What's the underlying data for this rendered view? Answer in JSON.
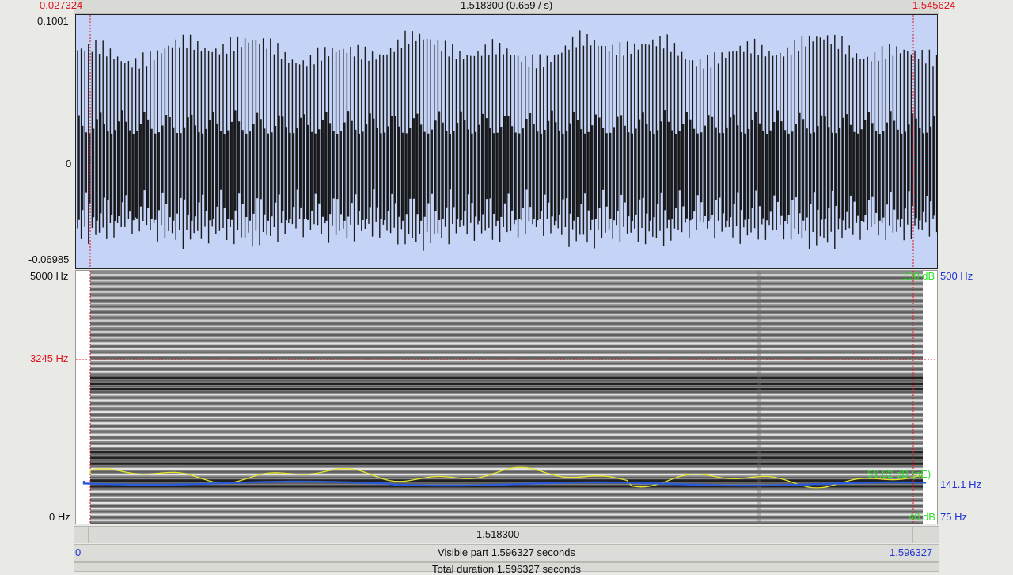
{
  "top": {
    "left_time": "0.027324",
    "selection": "1.518300 (0.659 / s)",
    "right_time": "1.545624"
  },
  "waveform": {
    "max_label": "0.1001",
    "zero_label": "0",
    "min_label": "-0.06985"
  },
  "spectrogram": {
    "top_label": "5000 Hz",
    "cursor_label": "3245 Hz",
    "bottom_label": "0 Hz",
    "right_db_top": "100 dB",
    "right_pitch_top": "500 Hz",
    "intensity_readout": "59.82 dB (nE)",
    "pitch_readout": "141.1 Hz",
    "right_db_bottom": "40 dB",
    "right_pitch_bottom": "75 Hz"
  },
  "bars": {
    "selection_duration": "1.518300",
    "visible_start": "0",
    "visible_part": "Visible part 1.596327 seconds",
    "visible_end": "1.596327",
    "total_duration": "Total duration 1.596327 seconds"
  },
  "colors": {
    "waveform_bg": "#c4d3f6",
    "selection_red": "#e0141e",
    "intensity_yellow": "#e6e62e",
    "pitch_blue": "#2a5ad8",
    "readout_green": "#2fe02a"
  }
}
